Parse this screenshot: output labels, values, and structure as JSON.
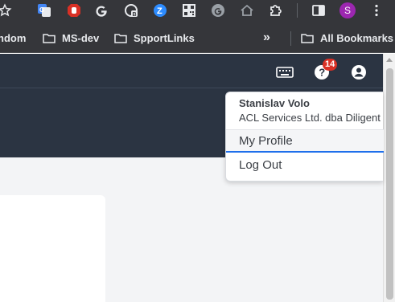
{
  "browser": {
    "extensions": [
      {
        "icon": "star-icon"
      },
      {
        "icon": "google-translate-icon"
      },
      {
        "icon": "stop-hand-icon"
      },
      {
        "icon": "google-g-icon"
      },
      {
        "icon": "camera-b-icon"
      },
      {
        "icon": "zoom-z-icon"
      },
      {
        "icon": "qr-code-icon"
      },
      {
        "icon": "g-circle-icon"
      },
      {
        "icon": "home-icon"
      },
      {
        "icon": "extensions-puzzle-icon"
      },
      {
        "icon": "side-panel-icon"
      },
      {
        "icon": "profile-avatar-icon",
        "text": "S"
      },
      {
        "icon": "more-vert-icon"
      }
    ],
    "profile_initial": "S",
    "bookmarks": [
      {
        "label": "ndom"
      },
      {
        "label": "MS-dev"
      },
      {
        "label": "SpportLinks"
      }
    ],
    "overflow_label": "»",
    "all_bookmarks_label": "All Bookmarks"
  },
  "header": {
    "help_badge_count": "14",
    "icons": [
      "keyboard-icon",
      "help-icon",
      "account-icon"
    ]
  },
  "user_menu": {
    "name": "Stanislav Volo",
    "organization": "ACL Services Ltd. dba Diligent",
    "items": [
      {
        "label": "My Profile"
      },
      {
        "label": "Log Out"
      }
    ]
  },
  "colors": {
    "browser_bg": "#35363a",
    "header_bg": "#2b3442",
    "badge": "#d93025",
    "accent": "#1f6feb",
    "avatar": "#9c27b0"
  }
}
